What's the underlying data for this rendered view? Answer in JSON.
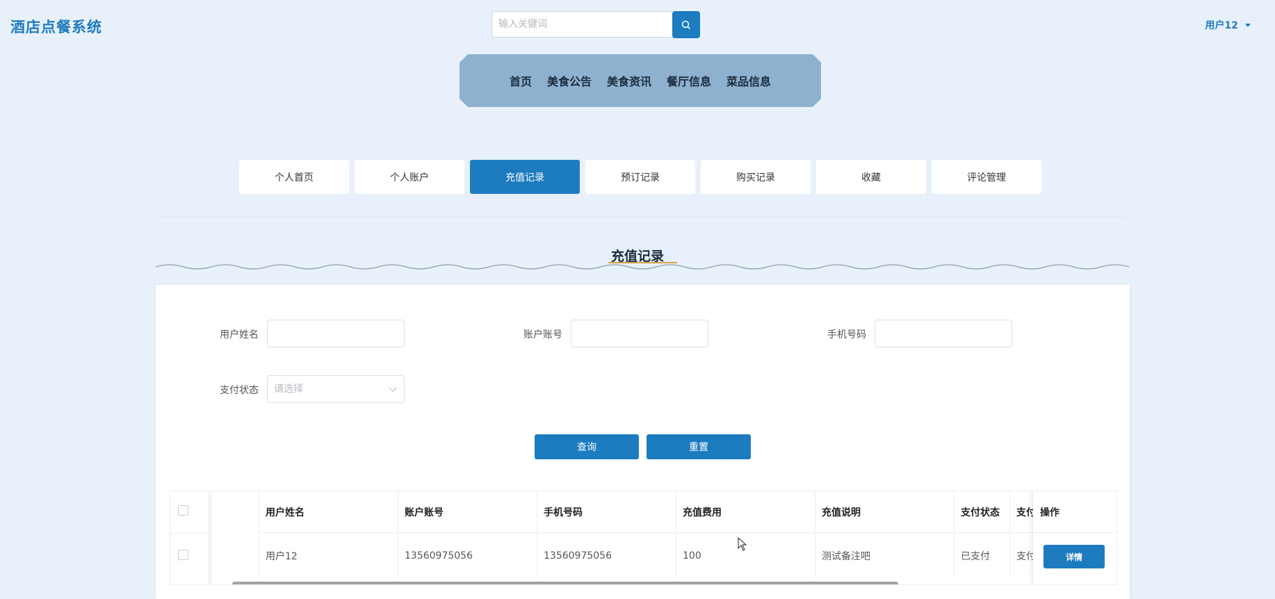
{
  "header": {
    "logo": "酒店点餐系统",
    "search_placeholder": "输入关键词",
    "user": "用户12"
  },
  "main_nav": [
    "首页",
    "美食公告",
    "美食资讯",
    "餐厅信息",
    "菜品信息"
  ],
  "sub_nav": {
    "tabs": [
      "个人首页",
      "个人账户",
      "充值记录",
      "预订记录",
      "购买记录",
      "收藏",
      "评论管理"
    ],
    "active": "充值记录"
  },
  "section_title": "充值记录",
  "filters": {
    "user_name_label": "用户姓名",
    "account_label": "账户账号",
    "phone_label": "手机号码",
    "pay_status_label": "支付状态",
    "pay_status_placeholder": "请选择"
  },
  "buttons": {
    "query": "查询",
    "reset": "重置"
  },
  "table": {
    "headers": [
      "用户姓名",
      "账户账号",
      "手机号码",
      "充值费用",
      "充值说明",
      "支付状态",
      "支付"
    ],
    "action_header": "操作",
    "rows": [
      {
        "name": "用户12",
        "account": "13560975056",
        "phone": "13560975056",
        "amount": "100",
        "note": "测试备注吧",
        "status": "已支付",
        "pay": "支付",
        "action": "详情"
      }
    ]
  }
}
